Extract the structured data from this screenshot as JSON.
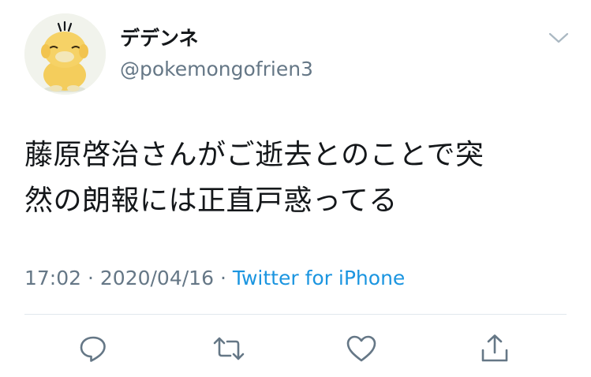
{
  "tweet": {
    "author": {
      "display_name": "デデンネ",
      "handle": "@pokemongofrien3",
      "avatar_icon": "psyduck-avatar-icon"
    },
    "text_lines": [
      "藤原啓治さんがご逝去とのことで突",
      "然の朗報には正直戸惑ってる"
    ],
    "timestamp": "17:02 · 2020/04/16",
    "separator": "·",
    "source": "Twitter for iPhone",
    "actions": {
      "reply_icon": "reply-icon",
      "retweet_icon": "retweet-icon",
      "like_icon": "like-icon",
      "share_icon": "share-icon"
    },
    "colors": {
      "text": "#14171a",
      "secondary": "#657786",
      "link": "#1b95e0",
      "divider": "#e1e8ed"
    }
  }
}
